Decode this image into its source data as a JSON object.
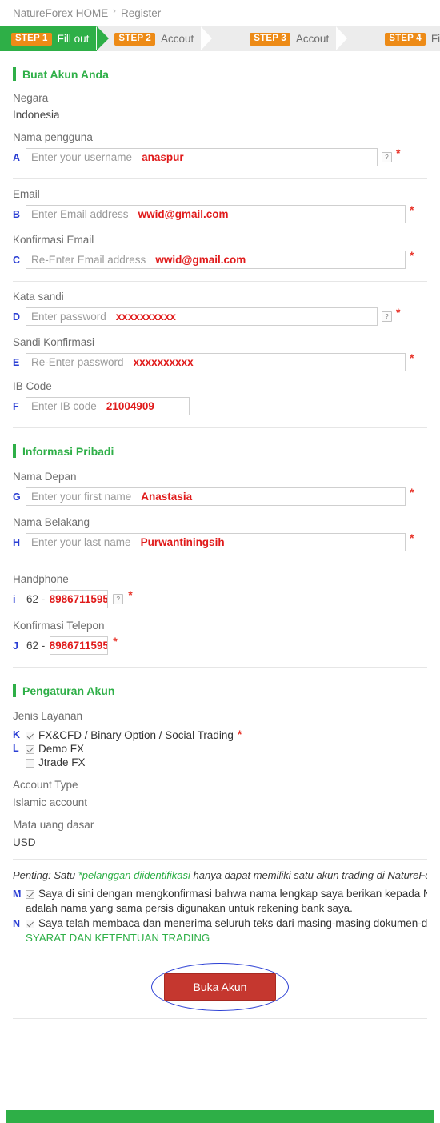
{
  "breadcrumb": {
    "home": "NatureForex HOME",
    "separator": "›",
    "current": "Register"
  },
  "steps": [
    {
      "badge": "STEP 1",
      "label": "Fill out",
      "active": true
    },
    {
      "badge": "STEP 2",
      "label": "Accout",
      "active": false
    },
    {
      "badge": "STEP 3",
      "label": "Accout",
      "active": false
    },
    {
      "badge": "STEP 4",
      "label": "Fin",
      "active": false
    }
  ],
  "sections": {
    "account": {
      "title": "Buat Akun Anda"
    },
    "personal": {
      "title": "Informasi Pribadi"
    },
    "settings": {
      "title": "Pengaturan Akun"
    }
  },
  "fields": {
    "country": {
      "label": "Negara",
      "value": "Indonesia"
    },
    "username": {
      "marker": "A",
      "label": "Nama pengguna",
      "placeholder": "Enter your username",
      "value": "anaspur",
      "help": "?",
      "required": "*"
    },
    "email": {
      "marker": "B",
      "label": "Email",
      "placeholder": "Enter Email address",
      "value": "wwid@gmail.com",
      "required": "*"
    },
    "email_confirm": {
      "marker": "C",
      "label": "Konfirmasi Email",
      "placeholder": "Re-Enter Email address",
      "value": "wwid@gmail.com",
      "required": "*"
    },
    "password": {
      "marker": "D",
      "label": "Kata sandi",
      "placeholder": "Enter password",
      "value": "xxxxxxxxxx",
      "help": "?",
      "required": "*"
    },
    "password_confirm": {
      "marker": "E",
      "label": "Sandi Konfirmasi",
      "placeholder": "Re-Enter password",
      "value": "xxxxxxxxxx",
      "required": "*"
    },
    "ib_code": {
      "marker": "F",
      "label": "IB Code",
      "placeholder": "Enter IB code",
      "value": "21004909"
    },
    "first_name": {
      "marker": "G",
      "label": "Nama Depan",
      "placeholder": "Enter your first name",
      "value": "Anastasia",
      "required": "*"
    },
    "last_name": {
      "marker": "H",
      "label": "Nama Belakang",
      "placeholder": "Enter your last name",
      "value": "Purwantiningsih",
      "required": "*"
    },
    "phone": {
      "marker": "i",
      "label": "Handphone",
      "country_code": "62 -",
      "value": "8986711595",
      "help": "?",
      "required": "*"
    },
    "phone_confirm": {
      "marker": "J",
      "label": "Konfirmasi Telepon",
      "country_code": "62 -",
      "value": "8986711595",
      "required": "*"
    }
  },
  "service": {
    "label": "Jenis Layanan",
    "options": [
      {
        "marker": "K",
        "label": "FX&CFD / Binary Option / Social Trading",
        "checked": true,
        "required": "*"
      },
      {
        "marker": "L",
        "label": "Demo FX",
        "checked": true,
        "required": ""
      },
      {
        "marker": "",
        "label": "Jtrade FX",
        "checked": false,
        "required": ""
      }
    ]
  },
  "account_type": {
    "label": "Account Type",
    "value": "Islamic account"
  },
  "currency": {
    "label": "Mata uang dasar",
    "value": "USD"
  },
  "notice": {
    "prefix": "Penting: Satu",
    "highlight": "*pelanggan diidentifikasi",
    "suffix": "hanya dapat memiliki satu akun trading di NatureFo"
  },
  "agreements": [
    {
      "marker": "M",
      "line1": "Saya di sini dengan mengkonfirmasi bahwa nama lengkap saya berikan kepada NatureFore",
      "line2": "adalah nama yang sama persis digunakan untuk rekening bank saya.",
      "checked": true
    },
    {
      "marker": "N",
      "line1": "Saya telah membaca dan menerima seluruh teks dari masing-masing dokumen-dokumen be",
      "link": "SYARAT DAN KETENTUAN TRADING",
      "checked": true
    }
  ],
  "submit": {
    "label": "Buka Akun"
  },
  "colors": {
    "green": "#2eaf47",
    "orange": "#ed8b17",
    "red_value": "#e01b1b",
    "marker_blue": "#2b3fd4",
    "button_red": "#c5372f"
  }
}
